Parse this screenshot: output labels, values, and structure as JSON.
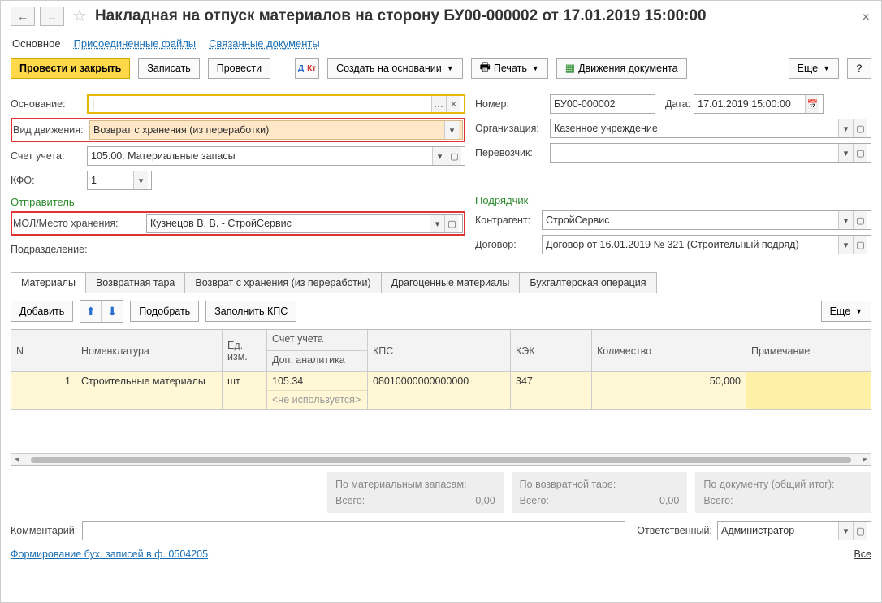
{
  "title": "Накладная на отпуск материалов на сторону БУ00-000002 от 17.01.2019 15:00:00",
  "navLinks": {
    "main": "Основное",
    "files": "Присоединенные файлы",
    "related": "Связанные документы"
  },
  "toolbar": {
    "post_close": "Провести и закрыть",
    "write": "Записать",
    "post": "Провести",
    "create_on_basis": "Создать на основании",
    "print": "Печать",
    "movements": "Движения документа",
    "more": "Еще"
  },
  "form": {
    "basis_lbl": "Основание:",
    "movement_type_lbl": "Вид движения:",
    "movement_type": "Возврат с хранения (из переработки)",
    "account_lbl": "Счет учета:",
    "account": "105.00. Материальные запасы",
    "kfo_lbl": "КФО:",
    "kfo": "1",
    "number_lbl": "Номер:",
    "number": "БУ00-000002",
    "date_lbl": "Дата:",
    "date": "17.01.2019 15:00:00",
    "org_lbl": "Организация:",
    "org": "Казенное учреждение",
    "carrier_lbl": "Перевозчик:",
    "section_sender": "Отправитель",
    "section_contractor": "Подрядчик",
    "mol_lbl": "МОЛ/Место хранения:",
    "mol": "Кузнецов В. В. - СтройСервис",
    "dept_lbl": "Подразделение:",
    "counterparty_lbl": "Контрагент:",
    "counterparty": "СтройСервис",
    "contract_lbl": "Договор:",
    "contract": "Договор от 16.01.2019 № 321 (Строительный подряд)"
  },
  "tabs": {
    "materials": "Материалы",
    "ret_tara": "Возвратная тара",
    "ret_storage": "Возврат с хранения (из переработки)",
    "precious": "Драгоценные материалы",
    "accounting": "Бухгалтерская операция"
  },
  "tabToolbar": {
    "add": "Добавить",
    "select": "Подобрать",
    "fill_kps": "Заполнить КПС",
    "more": "Еще"
  },
  "cols": {
    "n": "N",
    "nomenclature": "Номенклатура",
    "unit": "Ед. изм.",
    "account": "Счет учета",
    "extra": "Доп. аналитика",
    "kps": "КПС",
    "kek": "КЭК",
    "qty": "Количество",
    "note": "Примечание"
  },
  "row": {
    "n": "1",
    "nomenclature": "Строительные материалы",
    "unit": "шт",
    "account": "105.34",
    "extra": "<не используется>",
    "kps": "08010000000000000",
    "kek": "347",
    "qty": "50,000"
  },
  "totals": {
    "by_materials": "По материальным запасам:",
    "by_tara": "По возвратной таре:",
    "by_doc": "По документу (общий итог):",
    "total_lbl": "Всего:",
    "zero": "0,00"
  },
  "footer": {
    "comment_lbl": "Комментарий:",
    "responsible_lbl": "Ответственный:",
    "responsible": "Администратор",
    "link": "Формирование бух. записей в ф. 0504205",
    "all": "Все"
  }
}
